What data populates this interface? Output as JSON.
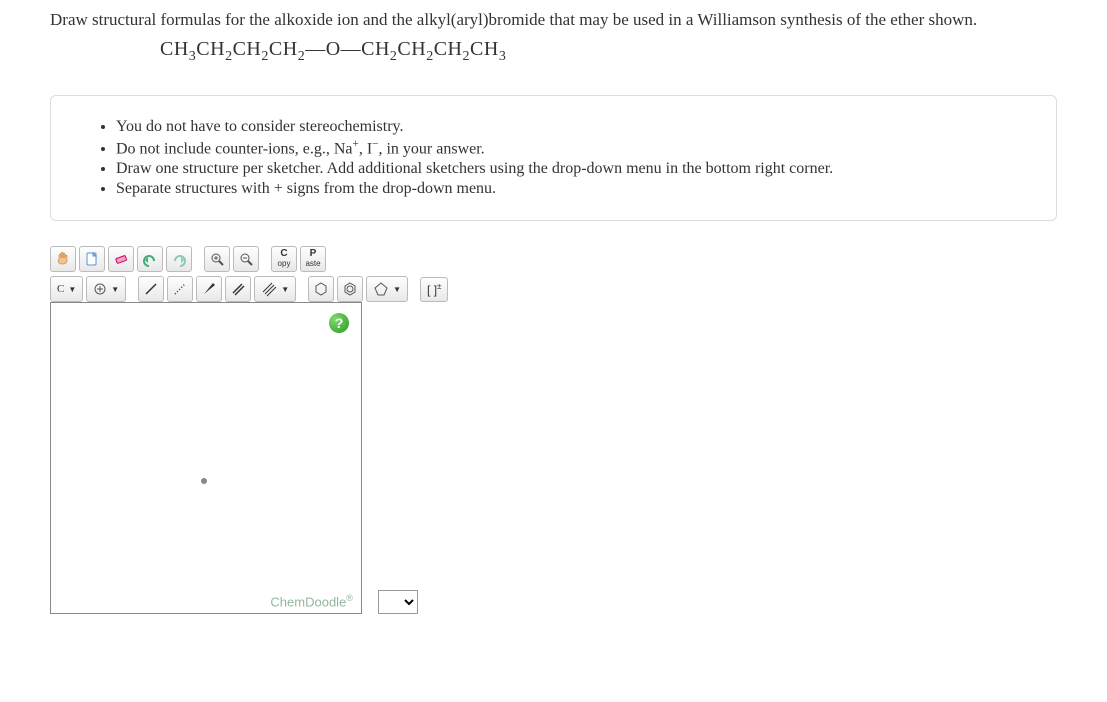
{
  "prompt": "Draw structural formulas for the alkoxide ion and the alkyl(aryl)bromide that may be used in a Williamson synthesis of the ether shown.",
  "formula_html": "CH<sub>3</sub>CH<sub>2</sub>CH<sub>2</sub>CH<sub>2</sub>—O—CH<sub>2</sub>CH<sub>2</sub>CH<sub>2</sub>CH<sub>3</sub>",
  "instructions": [
    "You do not have to consider stereochemistry.",
    "Do not include counter-ions, e.g., Na<sup>+</sup>, I<sup>−</sup>, in your answer.",
    "Draw one structure per sketcher. Add additional sketchers using the drop-down menu in the bottom right corner.",
    "Separate structures with + signs from the drop-down menu."
  ],
  "toolbar": {
    "copy_label": "C\nopy",
    "paste_label": "P\naste",
    "element_label": "C"
  },
  "help_label": "?",
  "charge_label": "[ ]ᶠ",
  "brand": "ChemDoodle",
  "brand_sup": "®"
}
